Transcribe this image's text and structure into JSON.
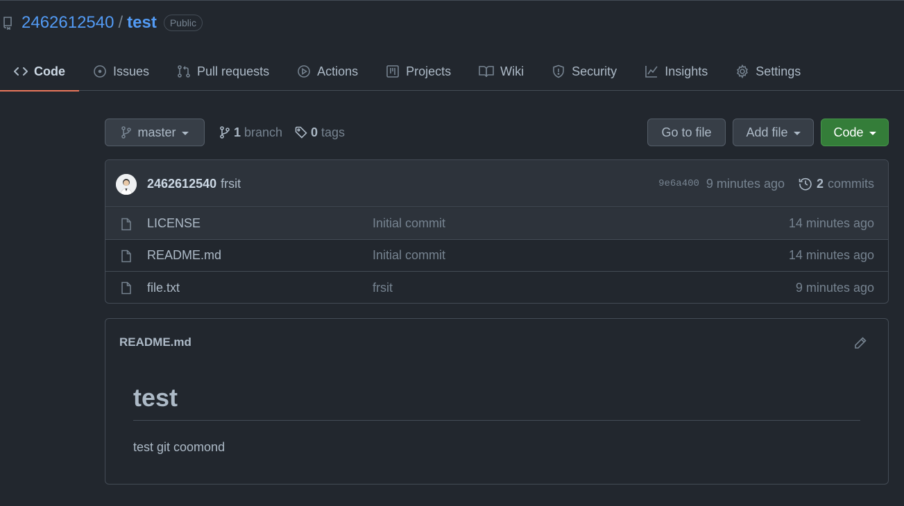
{
  "repo": {
    "owner": "2462612540",
    "separator": "/",
    "name": "test",
    "visibility": "Public"
  },
  "tabs": [
    {
      "label": "Code",
      "icon": "code-icon",
      "active": true
    },
    {
      "label": "Issues",
      "icon": "issue-icon"
    },
    {
      "label": "Pull requests",
      "icon": "pull-request-icon"
    },
    {
      "label": "Actions",
      "icon": "play-icon"
    },
    {
      "label": "Projects",
      "icon": "project-icon"
    },
    {
      "label": "Wiki",
      "icon": "book-icon"
    },
    {
      "label": "Security",
      "icon": "shield-icon"
    },
    {
      "label": "Insights",
      "icon": "graph-icon"
    },
    {
      "label": "Settings",
      "icon": "gear-icon"
    }
  ],
  "toolbar": {
    "branch": "master",
    "branches_count": "1",
    "branches_label": "branch",
    "tags_count": "0",
    "tags_label": "tags",
    "go_to_file": "Go to file",
    "add_file": "Add file",
    "code": "Code"
  },
  "latest_commit": {
    "author": "2462612540",
    "message": "frsit",
    "sha": "9e6a400",
    "time": "9 minutes ago",
    "commits_count": "2",
    "commits_label": "commits"
  },
  "files": [
    {
      "name": "LICENSE",
      "commit": "Initial commit",
      "age": "14 minutes ago"
    },
    {
      "name": "README.md",
      "commit": "Initial commit",
      "age": "14 minutes ago"
    },
    {
      "name": "file.txt",
      "commit": "frsit",
      "age": "9 minutes ago"
    }
  ],
  "readme": {
    "filename": "README.md",
    "heading": "test",
    "body": "test git coomond"
  },
  "colors": {
    "background": "#22272e",
    "link": "#539bf5",
    "active_tab_underline": "#ec775c",
    "code_button": "#347d39"
  }
}
